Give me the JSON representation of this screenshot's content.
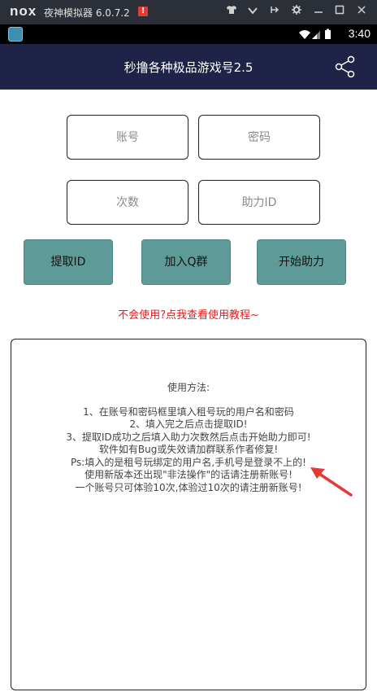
{
  "emulator": {
    "logo": "nox",
    "title": "夜神模拟器 6.0.7.2",
    "badge": "!",
    "controls": [
      "shirt-icon",
      "chevron-down-icon",
      "pin-icon",
      "gear-icon",
      "minimize-icon",
      "maximize-icon",
      "close-icon"
    ]
  },
  "status_bar": {
    "time": "3:40"
  },
  "header": {
    "title": "秒撸各种极品游戏号2.5"
  },
  "form": {
    "account_placeholder": "账号",
    "password_placeholder": "密码",
    "count_placeholder": "次数",
    "assist_id_placeholder": "助力ID"
  },
  "buttons": {
    "fetch_id": "提取ID",
    "join_group": "加入Q群",
    "start_assist": "开始助力"
  },
  "help_link": "不会使用?点我查看使用教程~",
  "instructions": {
    "heading": "使用方法:",
    "lines": [
      "1、在账号和密码框里填入租号玩的用户名和密码",
      "2、填入完之后点击提取ID!",
      "3、提取ID成功之后填入助力次数然后点击开始助力即可!",
      "软件如有Bug或失效请加群联系作者修复!",
      "Ps:填入的是租号玩绑定的用户名,手机号是登录不上的!",
      "使用新版本还出现\"非法操作\"的话请注册新账号!",
      "一个账号只可体验10次,体验过10次的请注册新账号!"
    ]
  },
  "colors": {
    "header_bg": "#1f2347",
    "button_bg": "#5e9b98",
    "link": "#e21b1b",
    "arrow": "#e53935"
  }
}
